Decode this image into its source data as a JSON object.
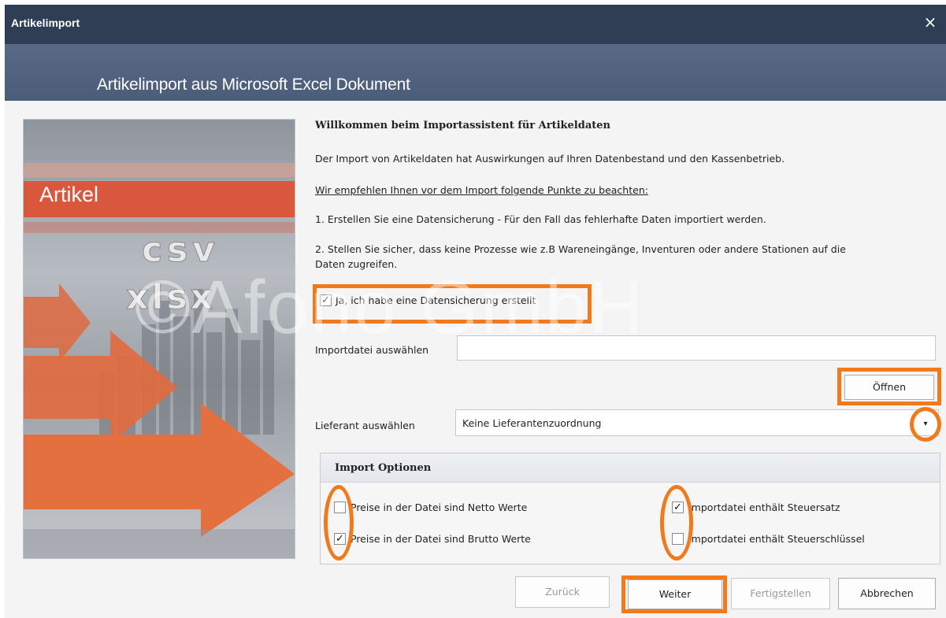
{
  "window": {
    "title": "Artikelimport",
    "close_glyph": "×"
  },
  "header": {
    "title": "Artikelimport aus Microsoft Excel Dokument"
  },
  "side_image": {
    "label_artikel": "Artikel",
    "label_csv": "csv",
    "label_xlsx": "xlsx"
  },
  "content": {
    "heading": "Willkommen beim Importassistent für Artikeldaten",
    "intro": "Der Import von Artikeldaten hat Auswirkungen auf Ihren Datenbestand und den Kassenbetrieb.",
    "recommend": "Wir empfehlen Ihnen vor dem Import folgende Punkte zu beachten:",
    "point1": "1. Erstellen Sie eine Datensicherung - Für den Fall das fehlerhafte Daten importiert werden.",
    "point2_line1": "2. Stellen Sie sicher, dass keine Prozesse wie z.B Wareneingänge, Inventuren oder andere Stationen auf die",
    "point2_line2": "Daten zugreifen.",
    "backup_checkbox": {
      "label": "Ja, ich habe eine Datensicherung erstellt",
      "checked": true
    },
    "file_label": "Importdatei auswählen",
    "file_value": "",
    "open_button": "Öffnen",
    "supplier_label": "Lieferant auswählen",
    "supplier_value": "Keine Lieferantenzuordnung"
  },
  "options": {
    "title": "Import Optionen",
    "netto": {
      "label": "Preise in der Datei sind Netto Werte",
      "checked": false
    },
    "brutto": {
      "label": "Preise in der Datei sind Brutto Werte",
      "checked": true
    },
    "steuersatz": {
      "label": "Importdatei enthält Steuersatz",
      "checked": true
    },
    "steuerschluessel": {
      "label": "Importdatei enthält Steuerschlüssel",
      "checked": false
    }
  },
  "buttons": {
    "back": "Zurück",
    "next": "Weiter",
    "finish": "Fertigstellen",
    "cancel": "Abbrechen"
  },
  "watermark": "©Afono GmbH",
  "colors": {
    "titlebar": "#2f3d55",
    "header": "#576985",
    "highlight": "#f07a1c",
    "artikel_band": "#d9573d"
  },
  "icons": {
    "close": "close-icon",
    "dropdown": "chevron-down-icon",
    "check": "checkmark-icon"
  }
}
